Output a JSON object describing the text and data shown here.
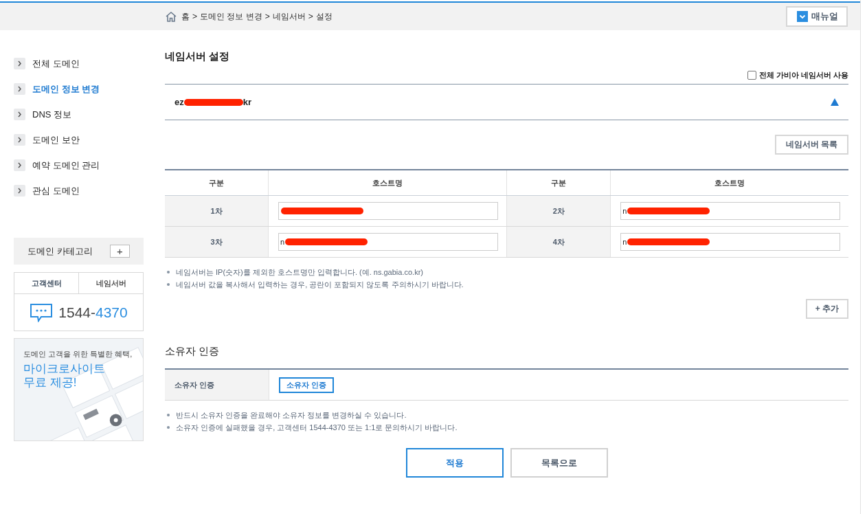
{
  "breadcrumb": [
    {
      "label": "홈"
    },
    {
      "separator": ">",
      "label": "도메인 정보 변경"
    },
    {
      "separator": ">",
      "label": "네임서버"
    },
    {
      "separator": ">",
      "label": "설정"
    }
  ],
  "manual_button": "매뉴얼",
  "sidebar": {
    "items": [
      {
        "label": "전체 도메인",
        "selected": false
      },
      {
        "label": "도메인 정보 변경",
        "selected": true
      },
      {
        "label": "DNS 정보",
        "selected": false
      },
      {
        "label": "도메인 보안",
        "selected": false
      },
      {
        "label": "예약 도메인 관리",
        "selected": false
      },
      {
        "label": "관심 도메인",
        "selected": false
      }
    ],
    "category": {
      "label": "도메인 카테고리",
      "button": "+"
    },
    "support": {
      "tabs": [
        {
          "label": "고객센터",
          "selected": true
        },
        {
          "label": "네임서버",
          "selected": false
        }
      ],
      "phone_prefix": "1544-",
      "phone_suffix": "4370"
    },
    "banner": {
      "kind": "picture",
      "subtitle": "도메인 고객을 위한 특별한 혜택,",
      "headline": [
        "마이크로사이트",
        "무료 제공!"
      ]
    }
  },
  "nameserver": {
    "title": "네임서버 설정",
    "use_all_gabia": {
      "label": "전체 가비아 네임서버 사용",
      "checked": false
    },
    "domain": {
      "start": "ez",
      "end": "kr",
      "redacted": true,
      "expanded": true
    },
    "list_button": "네임서버 목록",
    "columns": [
      "구분",
      "호스트명",
      "구분",
      "호스트명"
    ],
    "hosts": [
      {
        "label": "1차",
        "redacted": true
      },
      {
        "label": "2차",
        "value": "n",
        "redacted": true
      },
      {
        "label": "3차",
        "value": "n",
        "redacted": true
      },
      {
        "label": "4차",
        "value": "n",
        "redacted": true
      }
    ],
    "notes": [
      "네임서버는 IP(숫자)를 제외한 호스트명만 입력합니다. (예. ns.gabia.co.kr)",
      "네임서버 값을 복사해서 입력하는 경우, 공란이 포함되지 않도록 주의하시기 바랍니다."
    ],
    "add_button": "+ 추가"
  },
  "owner": {
    "title": "소유자 인증",
    "row_label": "소유자 인증",
    "button": "소유자 인증",
    "notes": [
      "반드시 소유자 인증을 완료해야 소유자 정보를 변경하실 수 있습니다.",
      "소유자 인증에 실패했을 경우, 고객센터 1544-4370 또는 1:1로 문의하시기 바랍니다."
    ]
  },
  "actions": [
    {
      "label": "적용",
      "kind": "primary"
    },
    {
      "label": "목록으로",
      "kind": "secondary"
    }
  ]
}
